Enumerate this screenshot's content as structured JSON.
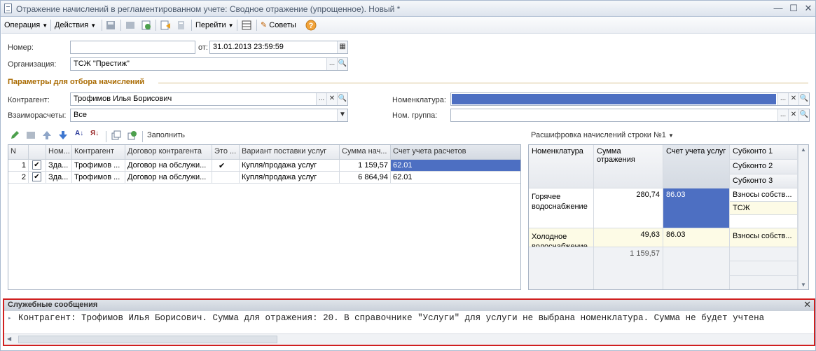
{
  "window": {
    "title": "Отражение начислений в регламентированном учете: Сводное отражение (упрощенное). Новый *"
  },
  "toolbar": {
    "operation_label": "Операция",
    "actions_label": "Действия",
    "goto_label": "Перейти",
    "tips_label": "Советы"
  },
  "form": {
    "number_label": "Номер:",
    "number_value": "",
    "from_label": "от:",
    "date_value": "31.01.2013 23:59:59",
    "org_label": "Организация:",
    "org_value": "ТСЖ \"Престиж\"",
    "params_title": "Параметры для отбора начислений",
    "counterparty_label": "Контрагент:",
    "counterparty_value": "Трофимов Илья Борисович",
    "settlements_label": "Взаиморасчеты:",
    "settlements_value": "Все",
    "nomenclature_label": "Номенклатура:",
    "nomenclature_value": "",
    "nomgroup_label": "Ном. группа:",
    "nomgroup_value": ""
  },
  "table_toolbar": {
    "fill_label": "Заполнить"
  },
  "main_table": {
    "headers": [
      "N",
      "",
      "Ном...",
      "Контрагент",
      "Договор контрагента",
      "Это ...",
      "Вариант поставки услуг",
      "Сумма нач...",
      "Счет учета расчетов"
    ],
    "rows": [
      {
        "n": "1",
        "checked": "✔",
        "nom": "Зда...",
        "counterparty": "Трофимов ...",
        "contract": "Договор на обслужи...",
        "flag": "✔",
        "variant": "Купля/продажа услуг",
        "sum": "1 159,57",
        "account": "62.01"
      },
      {
        "n": "2",
        "checked": "✔",
        "nom": "Зда...",
        "counterparty": "Трофимов ...",
        "contract": "Договор на обслужи...",
        "flag": "",
        "variant": "Купля/продажа услуг",
        "sum": "6 864,94",
        "account": "62.01"
      }
    ]
  },
  "detail": {
    "title": "Расшифровка начислений строки №1",
    "headers": {
      "nomenclature": "Номенклатура",
      "sum": "Сумма отражения",
      "account": "Счет учета услуг",
      "subconto1": "Субконто 1",
      "subconto2": "Субконто 2",
      "subconto3": "Субконто 3"
    },
    "rows": [
      {
        "nomenclature": "Горячее водоснабжение",
        "sum": "280,74",
        "account": "86.03",
        "sub1": "Взносы собств...",
        "sub2": "ТСЖ",
        "sub3": ""
      },
      {
        "nomenclature": "Холодное водоснабжение",
        "sum": "49,63",
        "account": "86.03",
        "sub1": "Взносы собств...",
        "sub2": "",
        "sub3": ""
      }
    ],
    "total": "1 159,57"
  },
  "messages": {
    "title": "Служебные сообщения",
    "text": "Контрагент: Трофимов Илья Борисович. Сумма для отражения: 20. В справочнике \"Услуги\" для услуги не выбрана номенклатура. Сумма не будет учтена"
  },
  "colors": {
    "selection": "#4d6fc2",
    "section": "#a96a00",
    "alert_border": "#d02020"
  },
  "icons": [
    "document-icon",
    "minimize-icon",
    "maximize-icon",
    "close-icon",
    "help-icon",
    "select-icon",
    "search-icon",
    "clear-icon",
    "calendar-icon",
    "pencil-icon",
    "sort-asc-icon",
    "sort-desc-icon",
    "move-up-icon",
    "move-down-icon"
  ]
}
